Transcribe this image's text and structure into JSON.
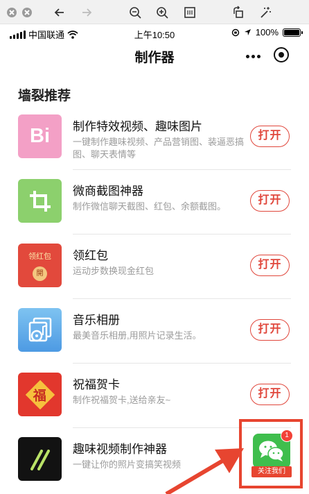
{
  "status_bar": {
    "carrier": "中国联通",
    "time": "上午10:50",
    "battery": "100%"
  },
  "nav": {
    "title": "制作器"
  },
  "section": {
    "title": "墙裂推荐"
  },
  "items": [
    {
      "name": "制作特效视频、趣味图片",
      "desc": "一键制作趣味视频、产品营销图、装逼恶搞图、聊天表情等",
      "action": "打开",
      "icon": "bi-icon",
      "icon_text": "Bi"
    },
    {
      "name": "微商截图神器",
      "desc": "制作微信聊天截图、红包、余额截图。",
      "action": "打开",
      "icon": "crop-icon"
    },
    {
      "name": "领红包",
      "desc": "运动步数换现金红包",
      "action": "打开",
      "icon": "red-packet-icon",
      "icon_text": "领红包",
      "icon_coin": "開"
    },
    {
      "name": "音乐相册",
      "desc": "最美音乐相册,用照片记录生活。",
      "action": "打开",
      "icon": "music-album-icon"
    },
    {
      "name": "祝福贺卡",
      "desc": "制作祝福贺卡,送给亲友~",
      "action": "打开",
      "icon": "fu-card-icon",
      "icon_text": "福"
    },
    {
      "name": "趣味视频制作神器",
      "desc": "一键让你的照片变搞笑视频",
      "icon": "fun-video-icon"
    }
  ],
  "float_button": {
    "badge": "1",
    "label": "关注我们",
    "icon": "wechat-icon"
  },
  "colors": {
    "accent": "#e0463b",
    "highlight": "#e74530"
  }
}
